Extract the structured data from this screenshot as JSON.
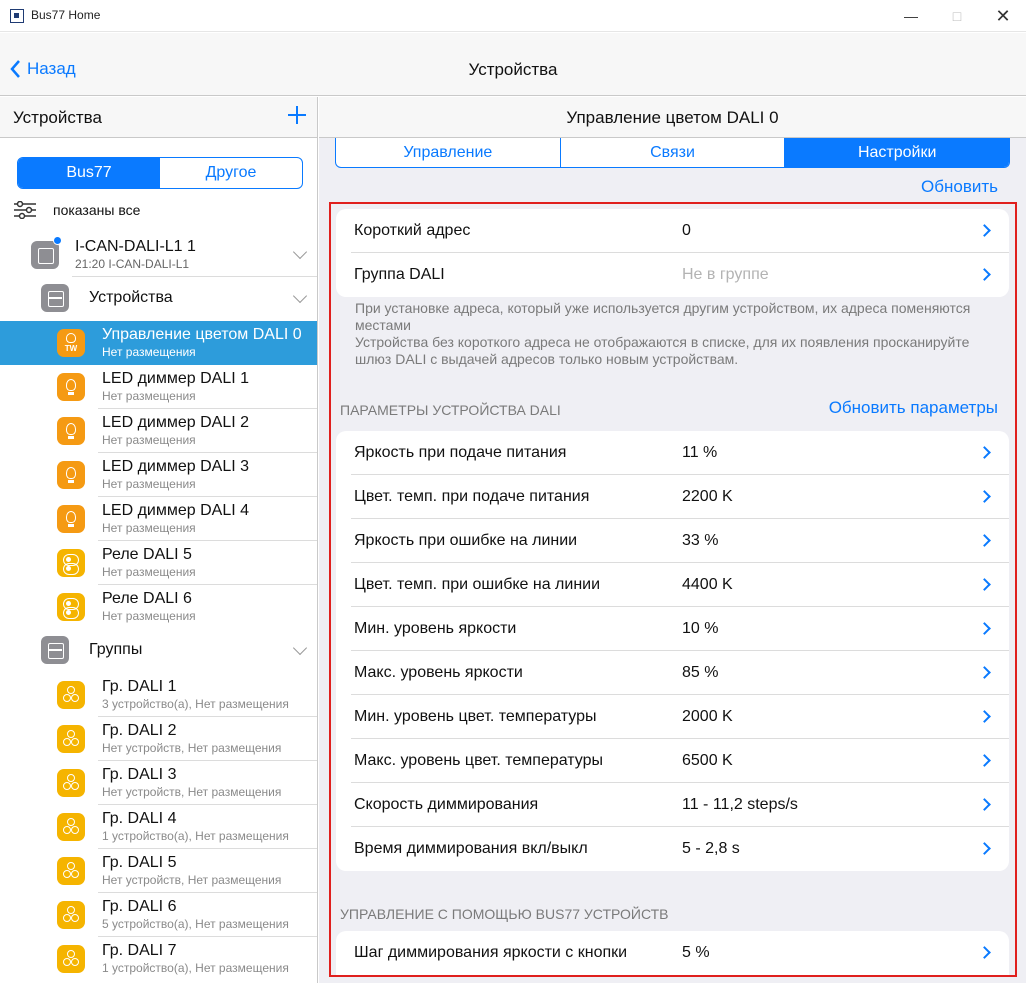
{
  "window": {
    "title": "Bus77 Home"
  },
  "nav": {
    "back_label": "Назад",
    "title": "Устройства"
  },
  "left_panel": {
    "title": "Устройства",
    "segments": [
      "Bus77",
      "Другое"
    ],
    "filter_label": "показаны все",
    "gateway": {
      "name": "I-CAN-DALI-L1 1",
      "sub": "21:20 I-CAN-DALI-L1"
    },
    "devices_folder": "Устройства",
    "groups_folder": "Группы",
    "devices": [
      {
        "name": "Управление цветом DALI 0",
        "sub": "Нет размещения",
        "icon": "tw-light-icon",
        "badge": "TW"
      },
      {
        "name": "LED диммер DALI 1",
        "sub": "Нет размещения",
        "icon": "bulb-icon"
      },
      {
        "name": "LED диммер DALI 2",
        "sub": "Нет размещения",
        "icon": "bulb-icon"
      },
      {
        "name": "LED диммер DALI 3",
        "sub": "Нет размещения",
        "icon": "bulb-icon"
      },
      {
        "name": "LED диммер DALI 4",
        "sub": "Нет размещения",
        "icon": "bulb-icon"
      },
      {
        "name": "Реле DALI 5",
        "sub": "Нет размещения",
        "icon": "relay-icon"
      },
      {
        "name": "Реле DALI 6",
        "sub": "Нет размещения",
        "icon": "relay-icon"
      }
    ],
    "groups": [
      {
        "name": "Гр. DALI 1",
        "sub": "3 устройство(а), Нет размещения"
      },
      {
        "name": "Гр. DALI 2",
        "sub": "Нет устройств, Нет размещения"
      },
      {
        "name": "Гр. DALI 3",
        "sub": "Нет устройств, Нет размещения"
      },
      {
        "name": "Гр. DALI 4",
        "sub": "1 устройство(а), Нет размещения"
      },
      {
        "name": "Гр. DALI 5",
        "sub": "Нет устройств, Нет размещения"
      },
      {
        "name": "Гр. DALI 6",
        "sub": "5 устройство(а), Нет размещения"
      },
      {
        "name": "Гр. DALI 7",
        "sub": "1 устройство(а), Нет размещения"
      }
    ]
  },
  "right_panel": {
    "title": "Управление цветом DALI 0",
    "tabs": [
      "Управление",
      "Связи",
      "Настройки"
    ],
    "active_tab": "Настройки",
    "refresh_label": "Обновить",
    "address_rows": [
      {
        "label": "Короткий адрес",
        "value": "0"
      },
      {
        "label": "Группа DALI",
        "value": "Не в группе"
      }
    ],
    "note": "При установке адреса, который уже используется другим устройством, их адреса поменяются местами\nУстройства без короткого адреса не отображаются в списке, для их появления просканируйте шлюз DALI с выдачей адресов только новым устройствам.",
    "params_section": "ПАРАМЕТРЫ УСТРОЙСТВА DALI",
    "params_refresh": "Обновить параметры",
    "params": [
      {
        "label": "Яркость при подаче питания",
        "value": "11 %"
      },
      {
        "label": "Цвет. темп. при подаче питания",
        "value": "2200 K"
      },
      {
        "label": "Яркость при ошибке на линии",
        "value": "33 %"
      },
      {
        "label": "Цвет. темп. при ошибке на линии",
        "value": "4400 K"
      },
      {
        "label": "Мин. уровень яркости",
        "value": "10 %"
      },
      {
        "label": "Макс. уровень яркости",
        "value": "85 %"
      },
      {
        "label": "Мин. уровень цвет. температуры",
        "value": "2000 K"
      },
      {
        "label": "Макс. уровень цвет. температуры",
        "value": "6500 K"
      },
      {
        "label": "Скорость диммирования",
        "value": "11 - 11,2 steps/s"
      },
      {
        "label": "Время диммирования вкл/выкл",
        "value": "5 - 2,8 s"
      }
    ],
    "bus_section": "УПРАВЛЕНИЕ С ПОМОЩЬЮ BUS77 УСТРОЙСТВ",
    "bus_rows": [
      {
        "label": "Шаг диммирования яркости с кнопки",
        "value": "5 %"
      }
    ]
  },
  "colors": {
    "accent": "#0a7aff",
    "selection": "#2d9cdb",
    "highlight_frame": "#e0201e",
    "device_orange": "#f59a13",
    "device_yellow": "#f5b400"
  }
}
